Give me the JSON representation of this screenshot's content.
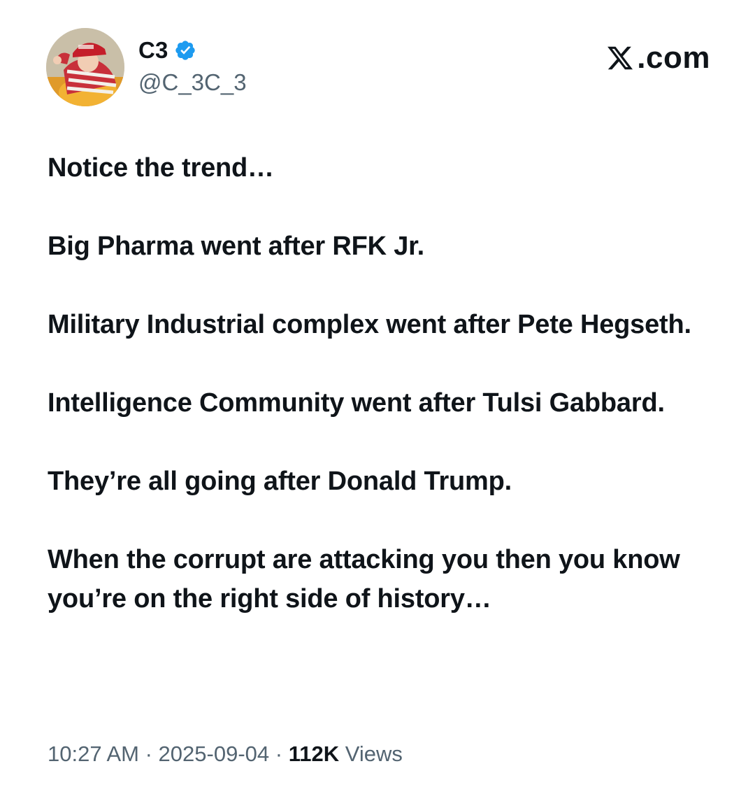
{
  "author": {
    "display_name": "C3",
    "handle": "@C_3C_3",
    "verified": true,
    "avatar_icon": "avatar-photo"
  },
  "brand": {
    "label": ".com",
    "icon": "x-logo-icon"
  },
  "tweet": {
    "paragraphs": [
      "Notice the trend…",
      "Big Pharma went after RFK Jr.",
      "Military Industrial complex went after Pete Hegseth.",
      "Intelligence Community went after Tulsi Gabbard.",
      "They’re all going after Donald Trump.",
      "When the corrupt are attacking you then you know you’re on the right side of history…"
    ]
  },
  "meta": {
    "time": "10:27 AM",
    "separator": " · ",
    "date": "2025-09-04",
    "views_count": "112K",
    "views_label": " Views"
  },
  "colors": {
    "text": "#0f1419",
    "secondary": "#536471",
    "verified_blue": "#1d9bf0"
  }
}
